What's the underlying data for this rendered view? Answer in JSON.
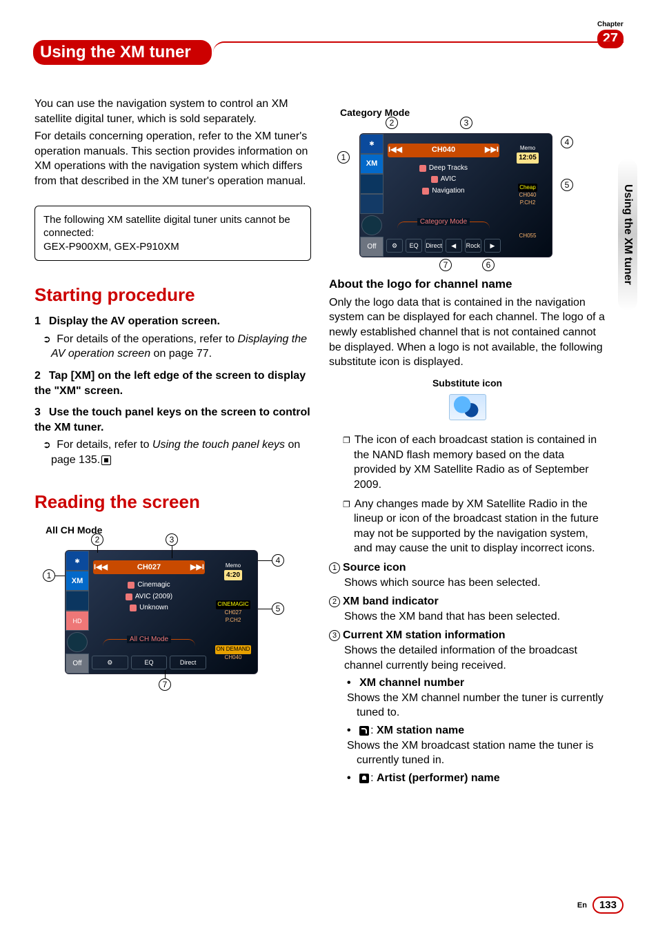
{
  "chapter": {
    "label": "Chapter",
    "number": "27"
  },
  "header": {
    "title": "Using the XM tuner"
  },
  "sidetab": "Using the XM tuner",
  "left": {
    "intro1": "You can use the navigation system to control an XM satellite digital tuner, which is sold separately.",
    "intro2": "For details concerning operation, refer to the XM tuner's operation manuals. This section provides information on XM operations with the navigation system which differs from that described in the XM tuner's operation manual.",
    "box_line1": "The following XM satellite digital tuner units cannot be connected:",
    "box_line2": "GEX-P900XM, GEX-P910XM",
    "h_start": "Starting procedure",
    "step1_head": "Display the AV operation screen.",
    "step1_sub_a": "For details of the operations, refer to ",
    "step1_sub_i": "Displaying the AV operation screen",
    "step1_sub_b": " on page 77.",
    "step2_head": "Tap [XM] on the left edge of the screen to display the \"XM\" screen.",
    "step3_head": "Use the touch panel keys on the screen to control the XM tuner.",
    "step3_sub_a": "For details, refer to ",
    "step3_sub_i": "Using the touch panel keys",
    "step3_sub_b": " on page 135.",
    "h_read": "Reading the screen",
    "fig1_caption": "All CH Mode",
    "fig1": {
      "memo": "Memo",
      "clock": "4:20",
      "ch": "CH027",
      "line1": "Cinemagic",
      "line2": "AVIC (2009)",
      "line3": "Unknown",
      "mode": "All CH Mode",
      "btn_eq": "EQ",
      "btn_direct": "Direct",
      "off": "Off",
      "xm": "XM",
      "logo1": "CINEMAGIC",
      "r2a": "CH027",
      "r2b": "P.CH2",
      "r3a": "ON DEMAND",
      "r3b": "CH040"
    },
    "callouts_fig1": [
      "1",
      "2",
      "3",
      "4",
      "5",
      "7"
    ]
  },
  "right": {
    "fig2_caption": "Category Mode",
    "fig2": {
      "memo": "Memo",
      "clock": "12:05",
      "ch": "CH040",
      "line1": "Deep Tracks",
      "line2": "AVIC",
      "line3": "Navigation",
      "mode": "Category Mode",
      "btn_eq": "EQ",
      "btn_direct": "Direct",
      "off": "Off",
      "xm": "XM",
      "nav_l": "◀",
      "nav_c": "Rock",
      "nav_r": "▶",
      "logo1": "Cheap",
      "r2a": "CH040",
      "r2b": "P.CH2",
      "r3b": "CH055"
    },
    "callouts_fig2": [
      "1",
      "2",
      "3",
      "4",
      "5",
      "6",
      "7"
    ],
    "h_logo": "About the logo for channel name",
    "logo_para": "Only the logo data that is contained in the navigation system can be displayed for each channel. The logo of a newly established channel that is not contained cannot be displayed. When a logo is not available, the following substitute icon is displayed.",
    "sub_icon_label": "Substitute icon",
    "note1": "The icon of each broadcast station is contained in the NAND flash memory based on the data provided by XM Satellite Radio as of September 2009.",
    "note2": "Any changes made by XM Satellite Radio in the lineup or icon of the broadcast station in the future may not be supported by the navigation system, and may cause the unit to display incorrect icons.",
    "n1": {
      "num": "1",
      "label": "Source icon",
      "desc": "Shows which source has been selected."
    },
    "n2": {
      "num": "2",
      "label": "XM band indicator",
      "desc": "Shows the XM band that has been selected."
    },
    "n3": {
      "num": "3",
      "label": "Current XM station information",
      "desc": "Shows the detailed information of the broadcast channel currently being received."
    },
    "b1": {
      "label": "XM channel number",
      "desc": "Shows the XM channel number the tuner is currently tuned to."
    },
    "b2": {
      "label": "XM station name",
      "desc": "Shows the XM broadcast station name the tuner is currently tuned in."
    },
    "b3": {
      "label": "Artist (performer) name"
    }
  },
  "footer": {
    "lang": "En",
    "page": "133"
  }
}
